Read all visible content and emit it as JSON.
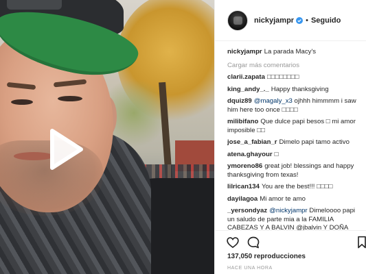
{
  "header": {
    "username": "nickyjampr",
    "separator": "•",
    "follow_status": "Seguido"
  },
  "caption": {
    "username": "nickyjampr",
    "text": "La parada Macy's"
  },
  "load_more": "Cargar más comentarios",
  "comments": [
    {
      "user": "clarii.zapata",
      "text": "□□□□□□□□"
    },
    {
      "user": "king_andy_._",
      "text": "Happy thanksgiving"
    },
    {
      "user": "dquiz89",
      "mention": "@magaly_x3",
      "text": " ojhhh himmmm i saw him here too once □□□□"
    },
    {
      "user": "milibifano",
      "text": "Que dulce papi besos □ mi amor imposible □□"
    },
    {
      "user": "jose_a_fabian_r",
      "text": "Dimelo papi tamo activo"
    },
    {
      "user": "atena.ghayour",
      "text": "□"
    },
    {
      "user": "ymoreno86",
      "text": "great job! blessings and happy thanksgiving from texas!"
    },
    {
      "user": "lilrican134",
      "text": "You are the best!!! □□□□"
    },
    {
      "user": "dayilagoa",
      "text": "Mi amor te amo"
    },
    {
      "user": "_yersondyaz",
      "mention": "@nickyjampr",
      "text": " Dimeloooo papi un saludo de parte mia a la FAMILIA CABEZAS Y A BALVIN @jbalvin Y DOÑA"
    }
  ],
  "stats": {
    "views": "137,050 reproducciones",
    "time": "HACE UNA HORA"
  },
  "icons": {
    "play": "play-icon",
    "heart": "heart-icon",
    "comment": "comment-icon",
    "bookmark": "bookmark-icon",
    "verified": "verified-badge-icon"
  },
  "colors": {
    "verified": "#3897f0",
    "mention": "#003569",
    "muted": "#999999",
    "cap_brim": "#2d8a45"
  }
}
